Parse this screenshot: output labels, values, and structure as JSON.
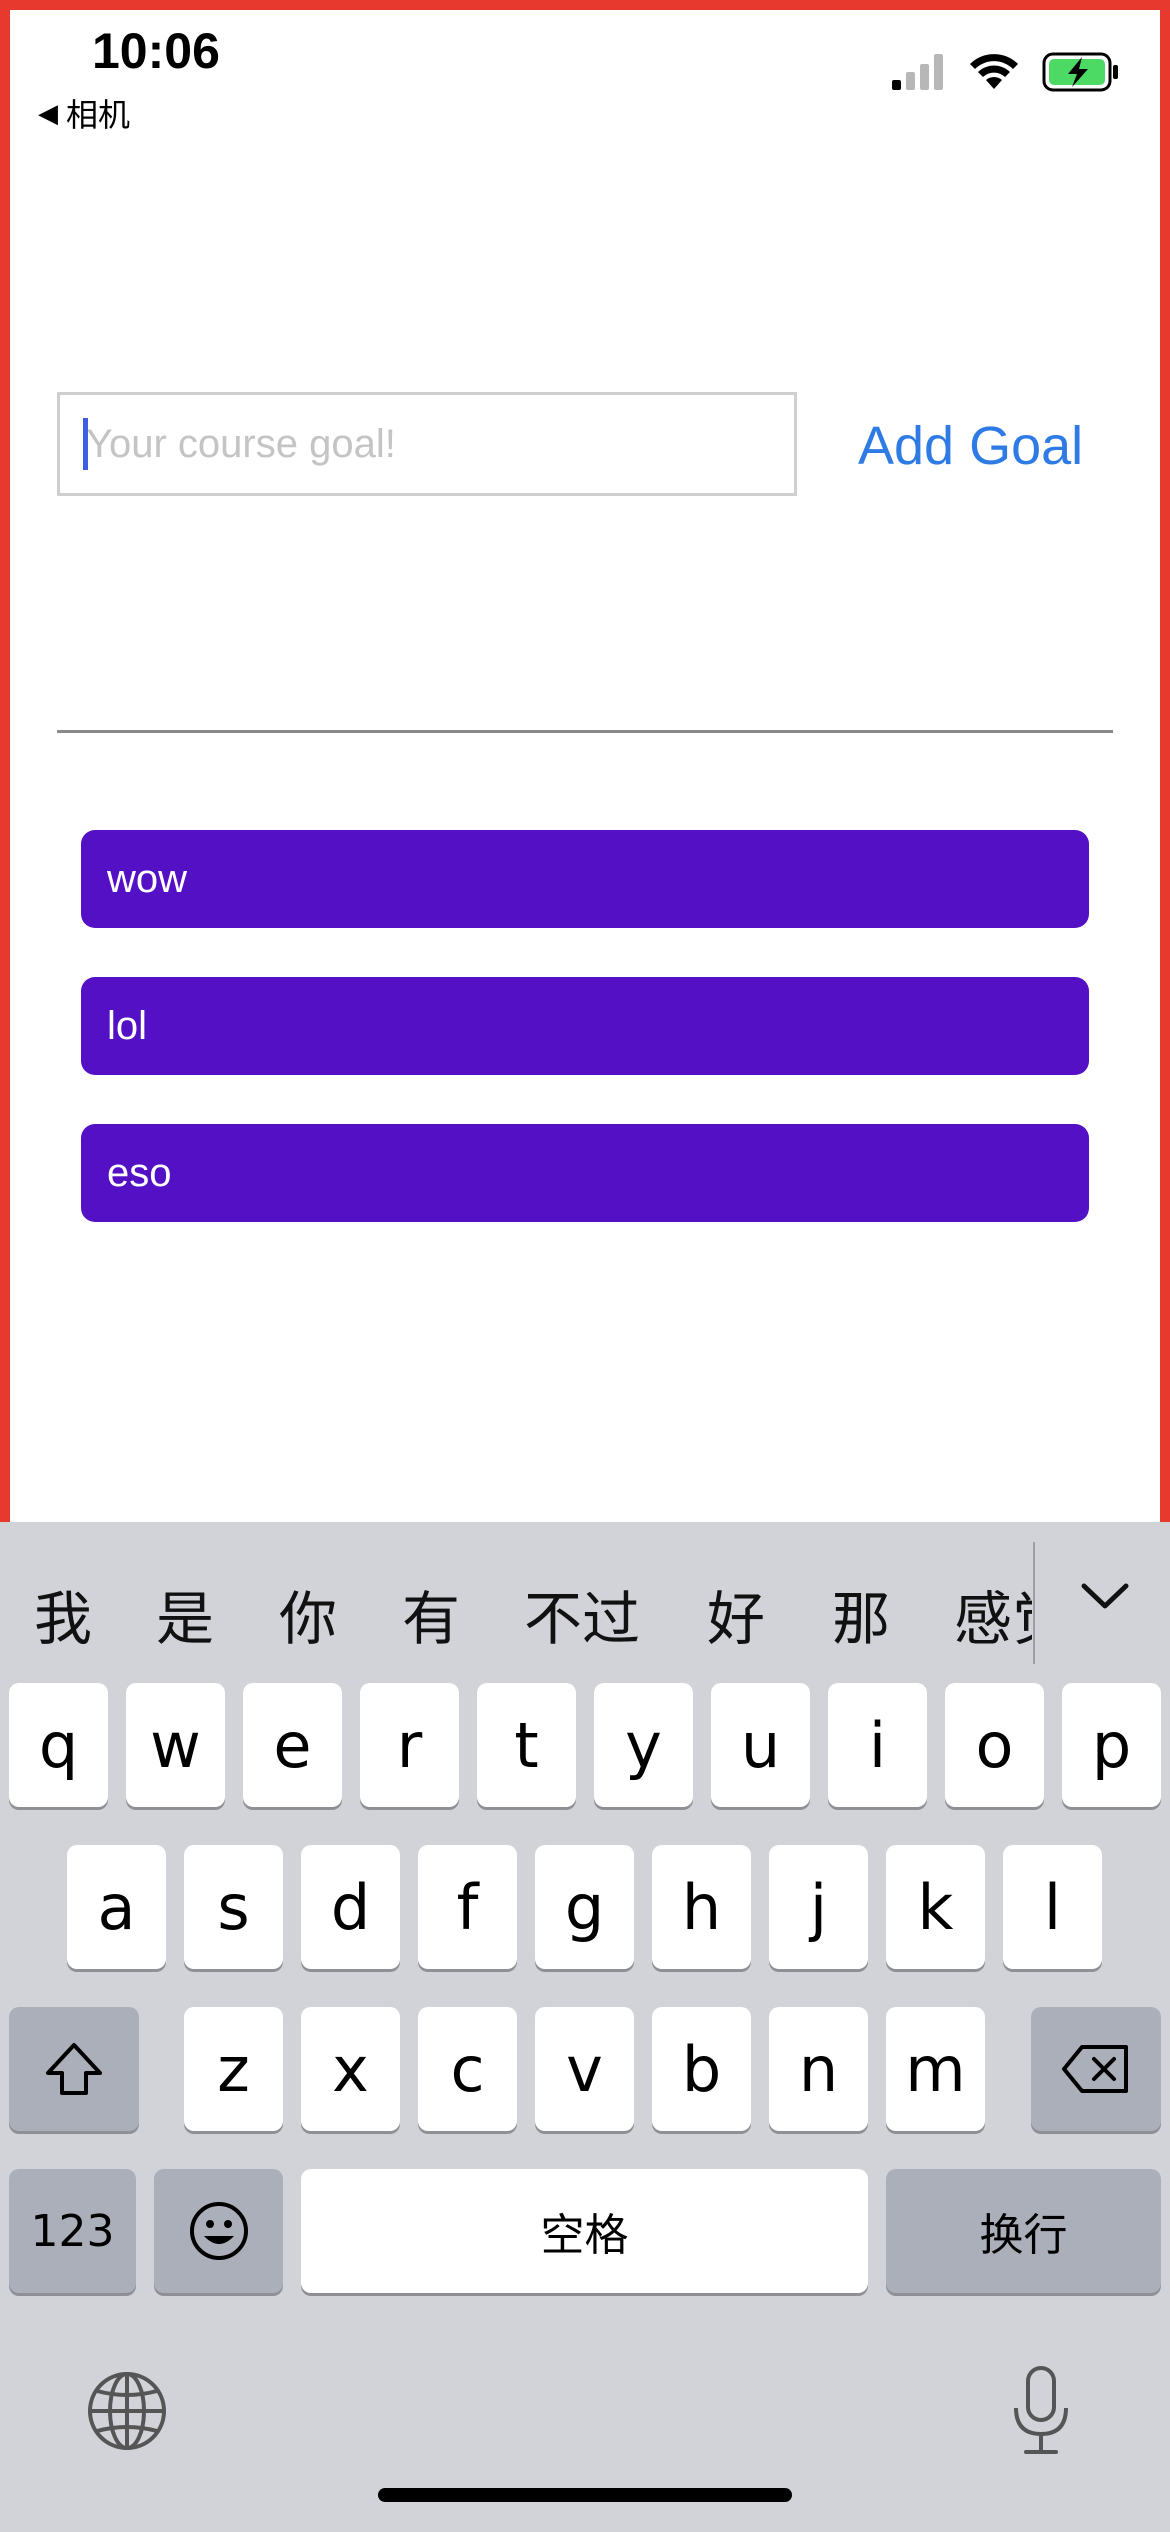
{
  "status_bar": {
    "time": "10:06",
    "back_label": "相机",
    "icons": [
      "signal-icon",
      "wifi-icon",
      "battery-charging-icon"
    ],
    "battery_color": "#4cd964"
  },
  "input": {
    "placeholder": "Your course goal!",
    "value": ""
  },
  "add_goal_label": "Add Goal",
  "goals": [
    {
      "label": "wow"
    },
    {
      "label": "lol"
    },
    {
      "label": "eso"
    }
  ],
  "colors": {
    "accent": "#2f7be6",
    "goal_item": "#5410c5",
    "frame": "#e8392f"
  },
  "keyboard": {
    "candidates": [
      "我",
      "是",
      "你",
      "有",
      "不过",
      "好",
      "那",
      "感觉"
    ],
    "row1": [
      "q",
      "w",
      "e",
      "r",
      "t",
      "y",
      "u",
      "i",
      "o",
      "p"
    ],
    "row2": [
      "a",
      "s",
      "d",
      "f",
      "g",
      "h",
      "j",
      "k",
      "l"
    ],
    "row3": [
      "z",
      "x",
      "c",
      "v",
      "b",
      "n",
      "m"
    ],
    "numbers_label": "123",
    "space_label": "空格",
    "return_label": "换行",
    "icons": [
      "shift-icon",
      "delete-icon",
      "emoji-icon",
      "globe-icon",
      "microphone-icon",
      "chevron-down-icon"
    ]
  }
}
